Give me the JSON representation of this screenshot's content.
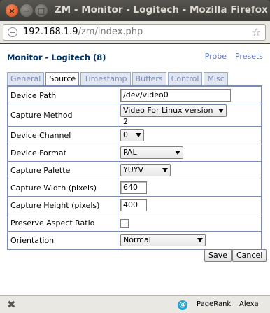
{
  "window": {
    "title": "ZM - Monitor - Logitech - Mozilla Firefox",
    "close_glyph": "×",
    "minimize_glyph": "−",
    "maximize_glyph": "□"
  },
  "address_bar": {
    "host": "192.168.1.9",
    "path": "/zm/index.php",
    "star_glyph": "☆"
  },
  "page": {
    "heading": "Monitor - Logitech (8)",
    "links": {
      "probe": "Probe",
      "presets": "Presets"
    },
    "tabs": [
      "General",
      "Source",
      "Timestamp",
      "Buffers",
      "Control",
      "Misc"
    ],
    "active_tab": "Source",
    "fields": {
      "device_path": {
        "label": "Device Path",
        "value": "/dev/video0"
      },
      "capture_method": {
        "label": "Capture Method",
        "value": "Video For Linux version 2"
      },
      "device_channel": {
        "label": "Device Channel",
        "value": "0"
      },
      "device_format": {
        "label": "Device Format",
        "value": "PAL"
      },
      "capture_palette": {
        "label": "Capture Palette",
        "value": "YUYV"
      },
      "capture_width": {
        "label": "Capture Width (pixels)",
        "value": "640"
      },
      "capture_height": {
        "label": "Capture Height (pixels)",
        "value": "400"
      },
      "preserve_aspect": {
        "label": "Preserve Aspect Ratio",
        "checked": false
      },
      "orientation": {
        "label": "Orientation",
        "value": "Normal"
      }
    },
    "buttons": {
      "save": "Save",
      "cancel": "Cancel"
    }
  },
  "status_bar": {
    "close_glyph": "✖",
    "badge_glyph": "@",
    "pagerank": "PageRank",
    "alexa": "Alexa"
  }
}
